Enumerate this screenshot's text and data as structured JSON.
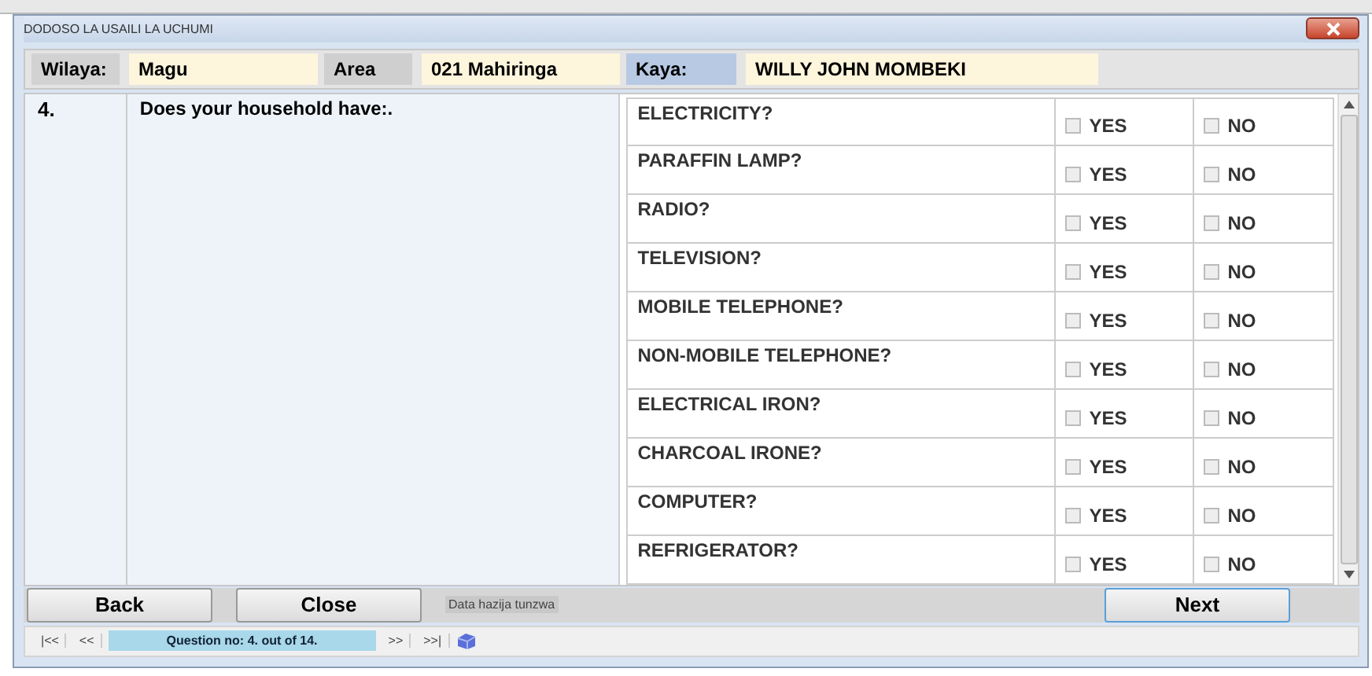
{
  "window": {
    "title": "DODOSO LA USAILI LA UCHUMI"
  },
  "header": [
    {
      "label": "Wilaya:",
      "value": "Magu"
    },
    {
      "label": "Area",
      "value": "021 Mahiringa"
    },
    {
      "label": "Kaya:",
      "value": "WILLY JOHN MOMBEKI"
    }
  ],
  "question": {
    "number": "4.",
    "text": "Does your household have:."
  },
  "items": [
    {
      "label": "ELECTRICITY?",
      "yes": {
        "text": "YES",
        "checked": false
      },
      "no": {
        "text": "NO",
        "checked": false
      }
    },
    {
      "label": "PARAFFIN LAMP?",
      "yes": {
        "text": "YES",
        "checked": false
      },
      "no": {
        "text": "NO",
        "checked": false
      }
    },
    {
      "label": "RADIO?",
      "yes": {
        "text": "YES",
        "checked": false
      },
      "no": {
        "text": "NO",
        "checked": false
      }
    },
    {
      "label": "TELEVISION?",
      "yes": {
        "text": "YES",
        "checked": false
      },
      "no": {
        "text": "NO",
        "checked": false
      }
    },
    {
      "label": "MOBILE TELEPHONE?",
      "yes": {
        "text": "YES",
        "checked": false
      },
      "no": {
        "text": "NO",
        "checked": false
      }
    },
    {
      "label": "NON-MOBILE TELEPHONE?",
      "yes": {
        "text": "YES",
        "checked": false
      },
      "no": {
        "text": "NO",
        "checked": false
      }
    },
    {
      "label": "ELECTRICAL IRON?",
      "yes": {
        "text": "YES",
        "checked": false
      },
      "no": {
        "text": "NO",
        "checked": false
      }
    },
    {
      "label": "CHARCOAL IRONE?",
      "yes": {
        "text": "YES",
        "checked": false
      },
      "no": {
        "text": "NO",
        "checked": false
      }
    },
    {
      "label": "COMPUTER?",
      "yes": {
        "text": "YES",
        "checked": false
      },
      "no": {
        "text": "NO",
        "checked": false
      }
    },
    {
      "label": "REFRIGERATOR?",
      "yes": {
        "text": "YES",
        "checked": false
      },
      "no": {
        "text": "NO",
        "checked": false
      }
    }
  ],
  "buttons": {
    "back": "Back",
    "close": "Close",
    "next": "Next"
  },
  "status": "Data hazija tunzwa",
  "navigator": {
    "first": "|<<",
    "prev": "<<",
    "position": "Question no: 4. out of 14.",
    "next": ">>",
    "last": ">>|"
  }
}
